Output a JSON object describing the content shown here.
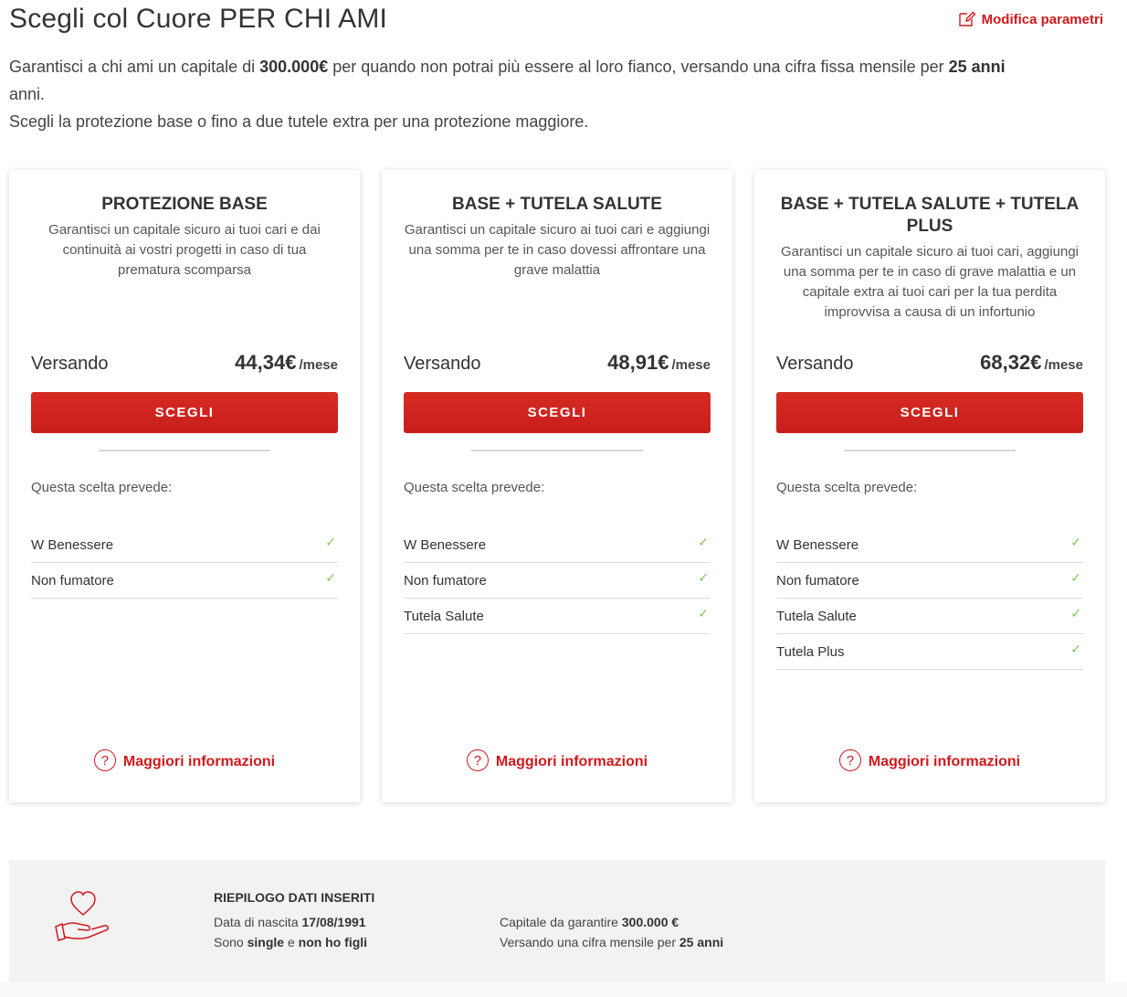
{
  "header": {
    "title": "Scegli col Cuore PER CHI AMI",
    "edit_label": "Modifica parametri"
  },
  "intro": {
    "line1_a": "Garantisci a chi ami un capitale di ",
    "capital": "300.000€",
    "line1_b": " per quando non potrai più essere al loro fianco, versando una cifra fissa mensile per ",
    "years": "25 anni",
    "line1_c": " anni.",
    "line2": "Scegli la protezione base o fino a due tutele extra per una protezione maggiore."
  },
  "cards": [
    {
      "title": "PROTEZIONE BASE",
      "description": "Garantisci un capitale sicuro ai tuoi cari e dai continuità ai vostri progetti in caso di tua prematura scomparsa",
      "price_label": "Versando",
      "price": "44,34€",
      "price_unit": "/mese",
      "button": "SCEGLI",
      "features_label": "Questa scelta prevede:",
      "features": [
        "W Benessere",
        "Non fumatore"
      ],
      "more_info": "Maggiori informazioni"
    },
    {
      "title": "BASE + TUTELA SALUTE",
      "description": "Garantisci un capitale sicuro ai tuoi cari e aggiungi una somma per te in caso dovessi affrontare una grave malattia",
      "price_label": "Versando",
      "price": "48,91€",
      "price_unit": "/mese",
      "button": "SCEGLI",
      "features_label": "Questa scelta prevede:",
      "features": [
        "W Benessere",
        "Non fumatore",
        "Tutela Salute"
      ],
      "more_info": "Maggiori informazioni"
    },
    {
      "title": "BASE + TUTELA SALUTE + TUTELA PLUS",
      "description": "Garantisci un capitale sicuro ai tuoi cari, aggiungi una somma per te in caso di grave malattia e un capitale extra ai tuoi cari per la tua perdita improvvisa a causa di un infortunio",
      "price_label": "Versando",
      "price": "68,32€",
      "price_unit": "/mese",
      "button": "SCEGLI",
      "features_label": "Questa scelta prevede:",
      "features": [
        "W Benessere",
        "Non fumatore",
        "Tutela Salute",
        "Tutela Plus"
      ],
      "more_info": "Maggiori informazioni"
    }
  ],
  "summary": {
    "title": "RIEPILOGO DATI INSERITI",
    "birth_label": "Data di nascita ",
    "birth_value": "17/08/1991",
    "status_a": "Sono ",
    "status_b": "single",
    "status_c": " e ",
    "status_d": "non ho figli",
    "capital_label": "Capitale da garantire ",
    "capital_value": "300.000 €",
    "duration_label": "Versando una cifra mensile per ",
    "duration_value": "25 anni"
  },
  "colors": {
    "accent": "#d0191c",
    "button": "#c81f1c",
    "check": "#7ec64f",
    "summary_bg": "#f2f2f2"
  },
  "icons": {
    "edit": "edit-pencil-icon",
    "check": "check-icon",
    "question": "question-circle-icon",
    "summary": "heart-hand-icon"
  }
}
